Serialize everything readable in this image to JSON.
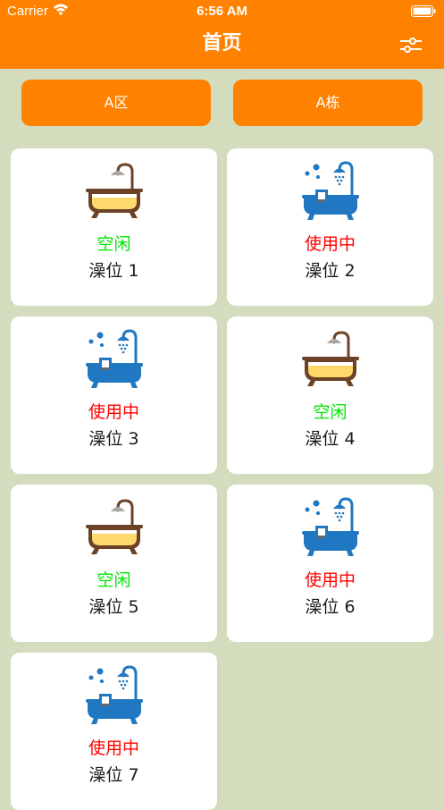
{
  "status_bar": {
    "carrier": "Carrier",
    "time": "6:56 AM"
  },
  "header": {
    "title": "首页",
    "filter_icon": "sliders-icon"
  },
  "selectors": {
    "area": "A区",
    "building": "A栋"
  },
  "colors": {
    "accent": "#fe8100",
    "background": "#d3dcbc",
    "idle": "#00e600",
    "busy": "#ff0000"
  },
  "stalls": [
    {
      "status": "空闲",
      "label": "澡位 1",
      "state": "idle",
      "icon": "empty-bathtub-icon"
    },
    {
      "status": "使用中",
      "label": "澡位 2",
      "state": "busy",
      "icon": "bathtub-shower-icon"
    },
    {
      "status": "使用中",
      "label": "澡位 3",
      "state": "busy",
      "icon": "bathtub-shower-icon"
    },
    {
      "status": "空闲",
      "label": "澡位 4",
      "state": "idle",
      "icon": "empty-bathtub-icon"
    },
    {
      "status": "空闲",
      "label": "澡位 5",
      "state": "idle",
      "icon": "empty-bathtub-icon"
    },
    {
      "status": "使用中",
      "label": "澡位 6",
      "state": "busy",
      "icon": "bathtub-shower-icon"
    },
    {
      "status": "使用中",
      "label": "澡位 7",
      "state": "busy",
      "icon": "bathtub-shower-icon"
    }
  ]
}
